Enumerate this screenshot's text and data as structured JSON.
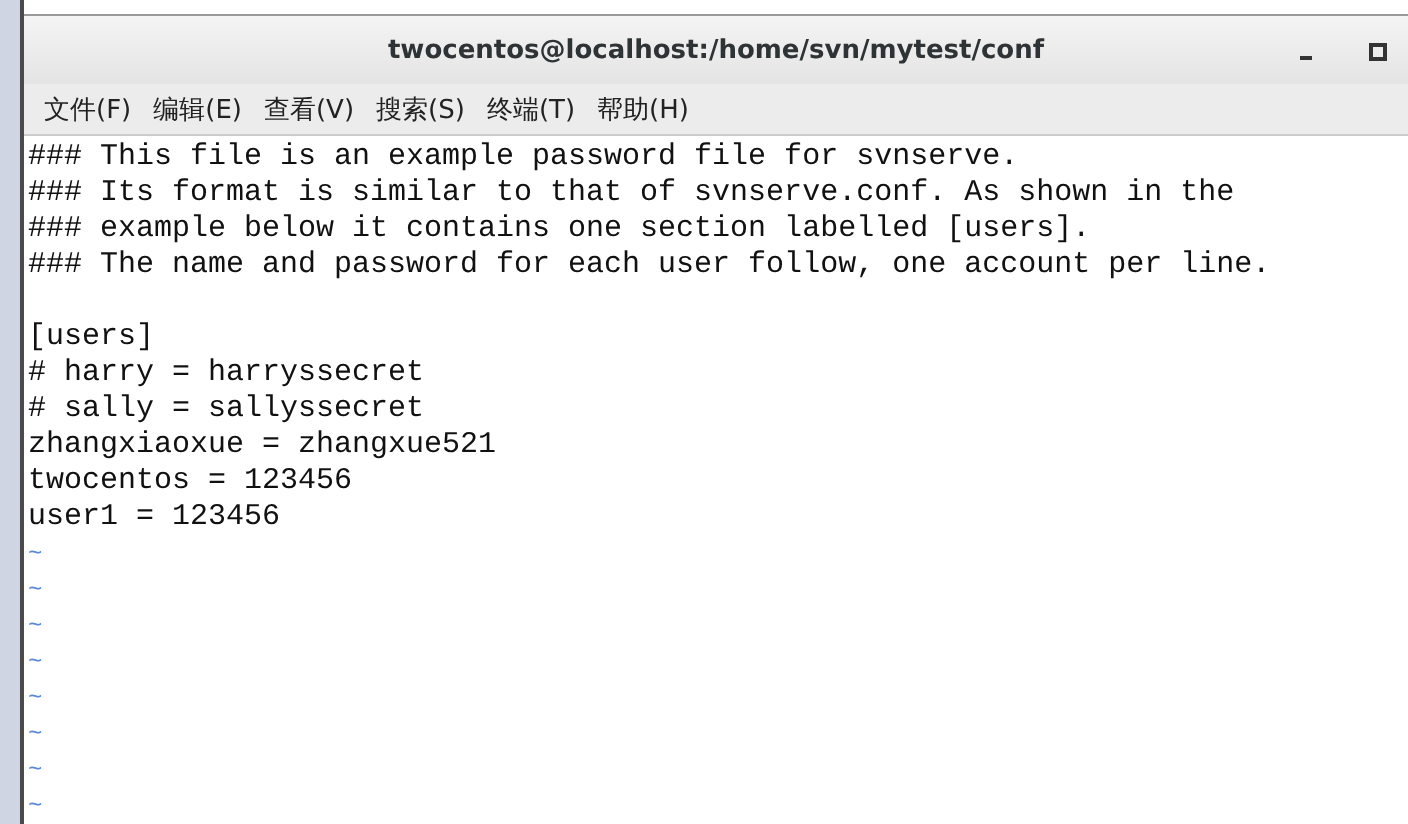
{
  "window": {
    "title": "twocentos@localhost:/home/svn/mytest/conf"
  },
  "menu": [
    {
      "label": "文件(F)"
    },
    {
      "label": "编辑(E)"
    },
    {
      "label": "查看(V)"
    },
    {
      "label": "搜索(S)"
    },
    {
      "label": "终端(T)"
    },
    {
      "label": "帮助(H)"
    }
  ],
  "editor": {
    "lines": [
      {
        "kind": "text",
        "text": "### This file is an example password file for svnserve."
      },
      {
        "kind": "text",
        "text": "### Its format is similar to that of svnserve.conf. As shown in the"
      },
      {
        "kind": "text",
        "text": "### example below it contains one section labelled [users]."
      },
      {
        "kind": "text",
        "text": "### The name and password for each user follow, one account per line."
      },
      {
        "kind": "blank"
      },
      {
        "kind": "text",
        "text": "[users]"
      },
      {
        "kind": "text",
        "text": "# harry = harryssecret"
      },
      {
        "kind": "text",
        "text": "# sally = sallyssecret"
      },
      {
        "kind": "text",
        "text": "zhangxiaoxue = zhangxue521"
      },
      {
        "kind": "text",
        "text": "twocentos = 123456"
      },
      {
        "kind": "text",
        "text": "user1 = 123456"
      },
      {
        "kind": "tilde",
        "text": "~"
      },
      {
        "kind": "tilde",
        "text": "~"
      },
      {
        "kind": "tilde",
        "text": "~"
      },
      {
        "kind": "tilde",
        "text": "~"
      },
      {
        "kind": "tilde",
        "text": "~"
      },
      {
        "kind": "tilde",
        "text": "~"
      },
      {
        "kind": "tilde",
        "text": "~"
      },
      {
        "kind": "tilde",
        "text": "~"
      }
    ]
  }
}
